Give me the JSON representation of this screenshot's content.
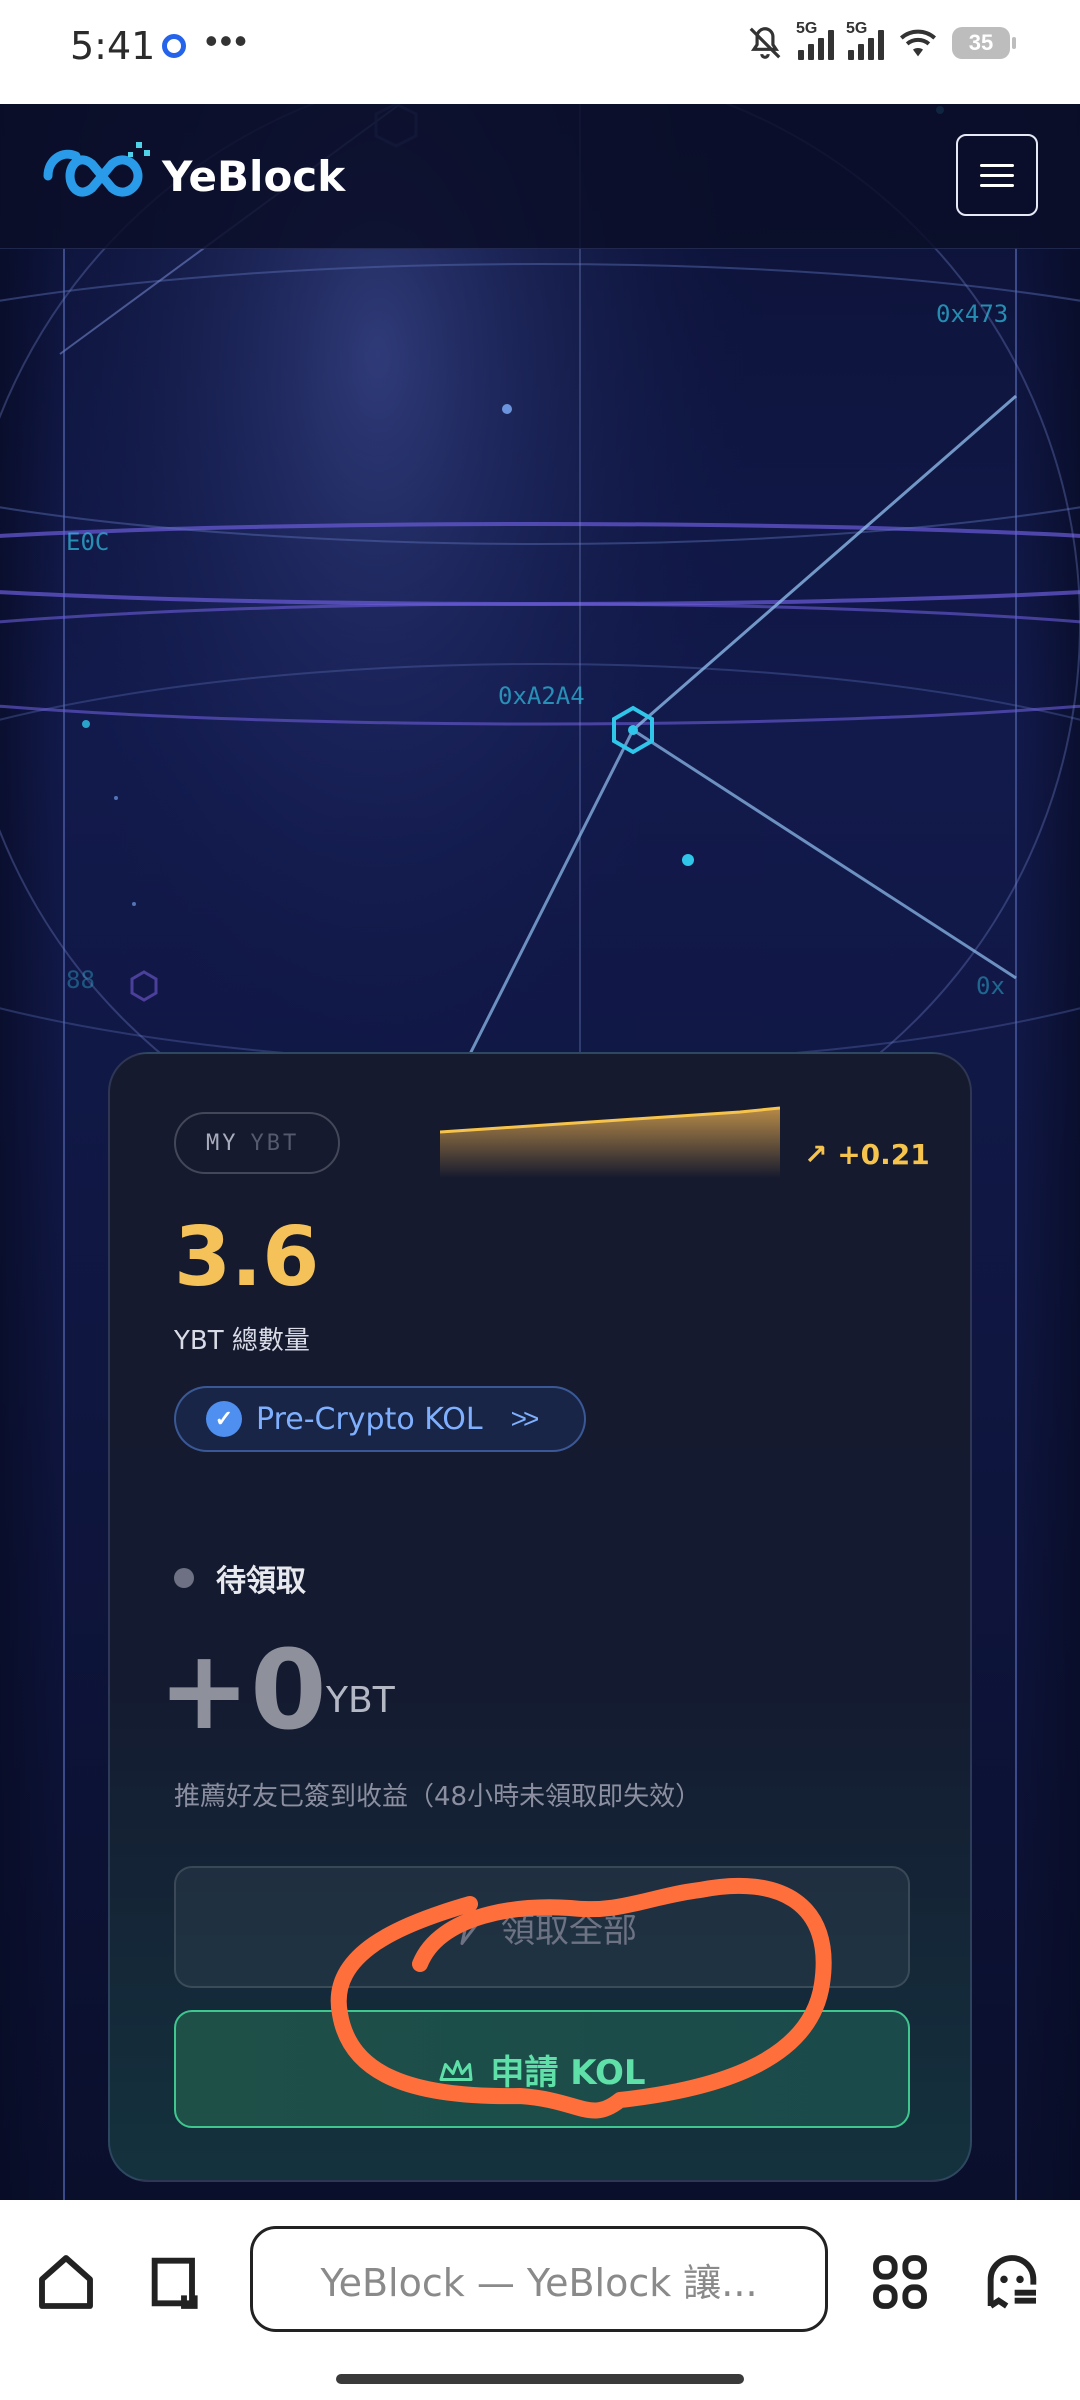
{
  "status_bar": {
    "time": "5:41",
    "more": "•••",
    "net1": "5G",
    "net2": "5G",
    "battery": "35"
  },
  "header": {
    "logo_text": "YeBlock"
  },
  "hero": {
    "hash_labels": [
      "0x473",
      "E0C",
      "0xA2A4",
      "88",
      "0x"
    ]
  },
  "card": {
    "token_pill": {
      "prefix": "MY",
      "suffix": "YBT"
    },
    "delta": "+0.21",
    "total_value": "3.6",
    "total_caption": "YBT 總數量",
    "kol_badge": "Pre-Crypto KOL",
    "kol_arrow": ">>",
    "pending_label": "待領取",
    "pending_value": "+0",
    "pending_unit": "YBT",
    "note": "推薦好友已簽到收益（48小時未領取即失效）",
    "claim_all_label": "領取全部",
    "apply_kol_label": "申請 KOL"
  },
  "browser": {
    "url_text": "YeBlock — YeBlock 讓..."
  },
  "colors": {
    "accent_gold": "#f5c25a",
    "accent_green": "#3fc78f",
    "accent_blue": "#4f8ff0",
    "annotation_orange": "#ff6f3c"
  }
}
